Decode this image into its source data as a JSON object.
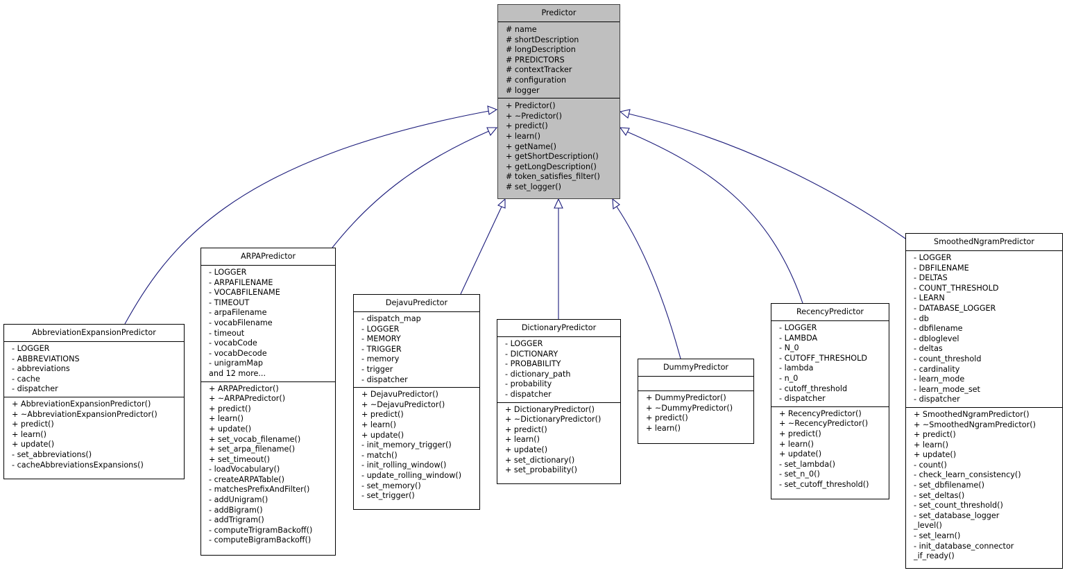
{
  "diagram": {
    "type": "uml-class-inheritance",
    "edge_color": "#1a1a7a",
    "base_fill": "#bfbfbf",
    "classes": {
      "predictor": {
        "name": "Predictor",
        "attributes": [
          "# name",
          "# shortDescription",
          "# longDescription",
          "# PREDICTORS",
          "# contextTracker",
          "# configuration",
          "# logger"
        ],
        "methods": [
          "+ Predictor()",
          "+ ~Predictor()",
          "+ predict()",
          "+ learn()",
          "+ getName()",
          "+ getShortDescription()",
          "+ getLongDescription()",
          "# token_satisfies_filter()",
          "# set_logger()"
        ]
      },
      "abbrev": {
        "name": "AbbreviationExpansionPredictor",
        "attributes": [
          "- LOGGER",
          "- ABBREVIATIONS",
          "- abbreviations",
          "- cache",
          "- dispatcher"
        ],
        "methods": [
          "+ AbbreviationExpansionPredictor()",
          "+ ~AbbreviationExpansionPredictor()",
          "+ predict()",
          "+ learn()",
          "+ update()",
          "- set_abbreviations()",
          "- cacheAbbreviationsExpansions()"
        ]
      },
      "arpa": {
        "name": "ARPAPredictor",
        "attributes": [
          "- LOGGER",
          "- ARPAFILENAME",
          "- VOCABFILENAME",
          "- TIMEOUT",
          "- arpaFilename",
          "- vocabFilename",
          "- timeout",
          "- vocabCode",
          "- vocabDecode",
          "- unigramMap",
          "and 12 more..."
        ],
        "methods": [
          "+ ARPAPredictor()",
          "+ ~ARPAPredictor()",
          "+ predict()",
          "+ learn()",
          "+ update()",
          "+ set_vocab_filename()",
          "+ set_arpa_filename()",
          "+ set_timeout()",
          "- loadVocabulary()",
          "- createARPATable()",
          "- matchesPrefixAndFilter()",
          "- addUnigram()",
          "- addBigram()",
          "- addTrigram()",
          "- computeTrigramBackoff()",
          "- computeBigramBackoff()"
        ]
      },
      "dejavu": {
        "name": "DejavuPredictor",
        "attributes": [
          "- dispatch_map",
          "- LOGGER",
          "- MEMORY",
          "- TRIGGER",
          "- memory",
          "- trigger",
          "- dispatcher"
        ],
        "methods": [
          "+ DejavuPredictor()",
          "+ ~DejavuPredictor()",
          "+ predict()",
          "+ learn()",
          "+ update()",
          "- init_memory_trigger()",
          "- match()",
          "- init_rolling_window()",
          "- update_rolling_window()",
          "- set_memory()",
          "- set_trigger()"
        ]
      },
      "dictionary": {
        "name": "DictionaryPredictor",
        "attributes": [
          "- LOGGER",
          "- DICTIONARY",
          "- PROBABILITY",
          "- dictionary_path",
          "- probability",
          "- dispatcher"
        ],
        "methods": [
          "+ DictionaryPredictor()",
          "+ ~DictionaryPredictor()",
          "+ predict()",
          "+ learn()",
          "+ update()",
          "+ set_dictionary()",
          "+ set_probability()"
        ]
      },
      "dummy": {
        "name": "DummyPredictor",
        "attributes": [],
        "methods": [
          "+ DummyPredictor()",
          "+ ~DummyPredictor()",
          "+ predict()",
          "+ learn()"
        ]
      },
      "recency": {
        "name": "RecencyPredictor",
        "attributes": [
          "- LOGGER",
          "- LAMBDA",
          "- N_0",
          "- CUTOFF_THRESHOLD",
          "- lambda",
          "- n_0",
          "- cutoff_threshold",
          "- dispatcher"
        ],
        "methods": [
          "+ RecencyPredictor()",
          "+ ~RecencyPredictor()",
          "+ predict()",
          "+ learn()",
          "+ update()",
          "- set_lambda()",
          "- set_n_0()",
          "- set_cutoff_threshold()"
        ]
      },
      "smoothed": {
        "name": "SmoothedNgramPredictor",
        "attributes": [
          "- LOGGER",
          "- DBFILENAME",
          "- DELTAS",
          "- COUNT_THRESHOLD",
          "- LEARN",
          "- DATABASE_LOGGER",
          "- db",
          "- dbfilename",
          "- dbloglevel",
          "- deltas",
          "- count_threshold",
          "- cardinality",
          "- learn_mode",
          "- learn_mode_set",
          "- dispatcher"
        ],
        "methods": [
          "+ SmoothedNgramPredictor()",
          "+ ~SmoothedNgramPredictor()",
          "+ predict()",
          "+ learn()",
          "+ update()",
          "- count()",
          "- check_learn_consistency()",
          "- set_dbfilename()",
          "- set_deltas()",
          "- set_count_threshold()",
          "- set_database_logger",
          "_level()",
          "- set_learn()",
          "- init_database_connector",
          "_if_ready()"
        ]
      }
    },
    "inheritance": [
      {
        "child": "abbrev",
        "parent": "predictor"
      },
      {
        "child": "arpa",
        "parent": "predictor"
      },
      {
        "child": "dejavu",
        "parent": "predictor"
      },
      {
        "child": "dictionary",
        "parent": "predictor"
      },
      {
        "child": "dummy",
        "parent": "predictor"
      },
      {
        "child": "recency",
        "parent": "predictor"
      },
      {
        "child": "smoothed",
        "parent": "predictor"
      }
    ]
  }
}
